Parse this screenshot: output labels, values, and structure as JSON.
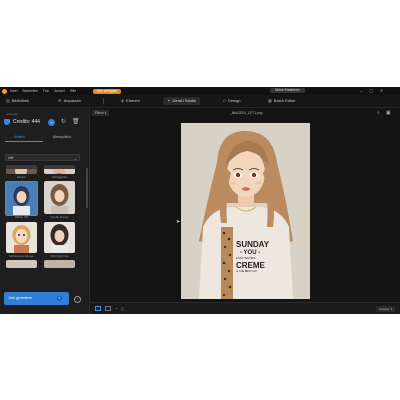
{
  "menubar": {
    "items": [
      "Datei",
      "Bearbeiten",
      "Foto",
      "Ansicht",
      "Hilfe"
    ],
    "update_label": "Neu verfügbar",
    "account_label": "Meine Kreationen",
    "window_controls": [
      "–",
      "▢",
      "✕"
    ]
  },
  "tabs": [
    {
      "icon": "library-icon",
      "label": "Bibliothek"
    },
    {
      "icon": "adjust-icon",
      "label": "Anpassen"
    },
    {
      "icon": "layers-icon",
      "label": "Ebenen"
    },
    {
      "icon": "genai-icon",
      "label": "GenAI Studio"
    },
    {
      "icon": "design-icon",
      "label": "Design"
    },
    {
      "icon": "batch-icon",
      "label": "Batch Editor"
    }
  ],
  "sidebar": {
    "section_label": "AI Kunst",
    "credits_label": "Credits: 444",
    "gen_tabs": [
      "Artistic",
      "Menschlich"
    ],
    "select_value": "Alle",
    "thumbnails": [
      {
        "label": "Zauber"
      },
      {
        "label": "Schlagkraft"
      },
      {
        "label": "Aktive Stil"
      },
      {
        "label": "Sanfte Puppe"
      },
      {
        "label": "Schlüsselanhänger"
      },
      {
        "label": "Grimmig Frau"
      }
    ],
    "generate_label": "Jetzt generieren",
    "generate_cost": "5",
    "help_icon": "?"
  },
  "main": {
    "filter_label": "Filtern ▾",
    "file_name": "_IMAGE03_12771.png",
    "zoom_label": "Anpass. ▾",
    "canvas_text": {
      "line1": "SUNDAY",
      "line2": "- YOU -",
      "line3": "& ANY WAITING",
      "line4": "CREME",
      "line5": "★ THE BEST DAY"
    }
  },
  "colors": {
    "accent": "#2f7fd8",
    "update": "#e08a1e",
    "background": "#1b1b1b"
  }
}
